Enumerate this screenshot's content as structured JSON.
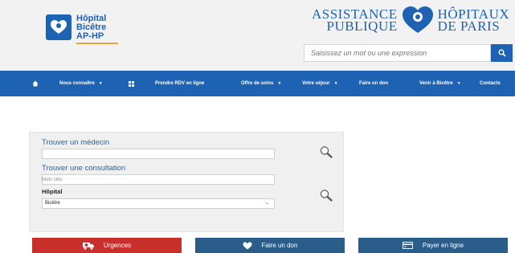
{
  "brand": {
    "hospital_line1": "Hôpital",
    "hospital_line2": "Bicêtre",
    "hospital_line3": "AP-HP",
    "aphp_left_line1": "ASSISTANCE",
    "aphp_left_line2": "PUBLIQUE",
    "aphp_right_line1": "HÔPITAUX",
    "aphp_right_line2": "DE  PARIS",
    "primary_color": "#1d62b3",
    "accent_color": "#e8a33a"
  },
  "search": {
    "placeholder": "Saisissez un mot ou une expression",
    "button_icon": "search-icon"
  },
  "nav": {
    "home_icon": "home-icon",
    "items": [
      {
        "label": "Nous connaître",
        "has_dropdown": true
      },
      {
        "label": "",
        "icon": "grid-icon"
      },
      {
        "label": "Prendre RDV en ligne",
        "has_dropdown": false
      },
      {
        "label": "Offre de soins",
        "has_dropdown": true
      },
      {
        "label": "Votre séjour",
        "has_dropdown": true
      },
      {
        "label": "Faire un don",
        "has_dropdown": false
      },
      {
        "label": "Venir à Bicêtre",
        "has_dropdown": true
      },
      {
        "label": "Contacts",
        "has_dropdown": false
      }
    ]
  },
  "finder": {
    "doctor_label": "Trouver un médecin",
    "consult_label": "Trouver une consultation",
    "keywords_label": "Mots clés",
    "hospital_label": "Hôpital",
    "hospital_selected": "Bicêtre"
  },
  "actions": {
    "urgences": {
      "label": "Urgences",
      "color": "#c9302c",
      "icon": "ambulance-icon"
    },
    "don": {
      "label": "Faire un don",
      "color": "#2b5d8a",
      "icon": "heart-icon"
    },
    "payer": {
      "label": "Payer en ligne",
      "color": "#2b5d8a",
      "icon": "card-icon"
    }
  }
}
